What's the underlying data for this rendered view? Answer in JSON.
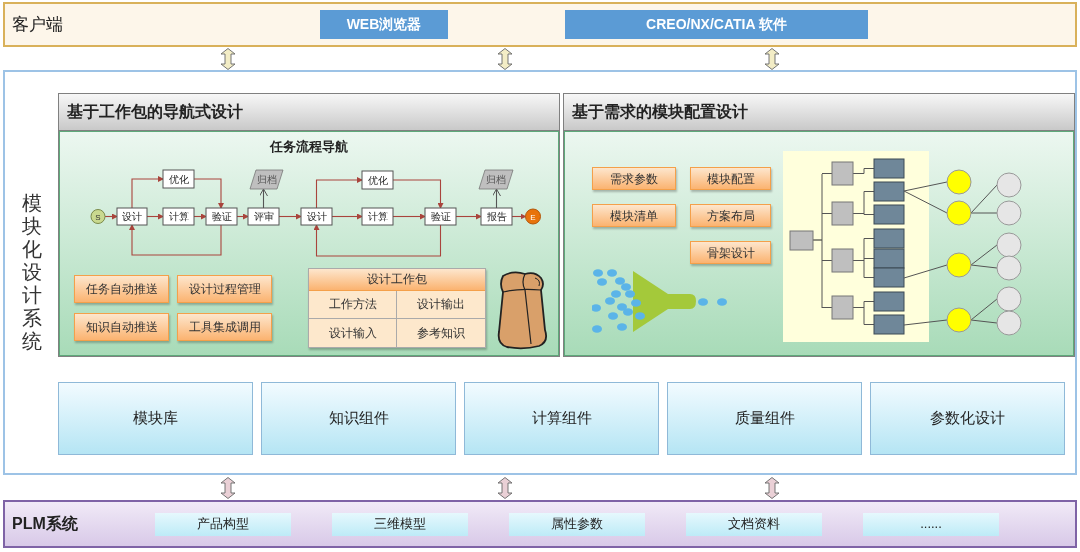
{
  "client": {
    "title": "客户端",
    "apps": [
      "WEB浏览器",
      "CREO/NX/CATIA 软件"
    ]
  },
  "system": {
    "title": "模块化设计系统",
    "left_panel": {
      "title": "基于工作包的导航式设计",
      "flow_title": "任务流程导航",
      "flow_nodes": [
        {
          "kind": "start",
          "label": "S"
        },
        {
          "kind": "step",
          "label": "设计"
        },
        {
          "kind": "step",
          "label": "优化"
        },
        {
          "kind": "step",
          "label": "计算"
        },
        {
          "kind": "step",
          "label": "验证"
        },
        {
          "kind": "archive",
          "label": "归档"
        },
        {
          "kind": "step",
          "label": "评审"
        },
        {
          "kind": "step",
          "label": "设计"
        },
        {
          "kind": "step",
          "label": "优化"
        },
        {
          "kind": "step",
          "label": "计算"
        },
        {
          "kind": "step",
          "label": "验证"
        },
        {
          "kind": "archive",
          "label": "归档"
        },
        {
          "kind": "step",
          "label": "报告"
        },
        {
          "kind": "end",
          "label": "E"
        }
      ],
      "features": [
        "任务自动推送",
        "设计过程管理",
        "知识自动推送",
        "工具集成调用"
      ],
      "work_package": {
        "title": "设计工作包",
        "cells": [
          "工作方法",
          "设计输出",
          "设计输入",
          "参考知识"
        ]
      }
    },
    "right_panel": {
      "title": "基于需求的模块配置设计",
      "features": [
        "需求参数",
        "模块配置",
        "模块清单",
        "方案布局",
        "骨架设计"
      ]
    },
    "components": [
      "模块库",
      "知识组件",
      "计算组件",
      "质量组件",
      "参数化设计"
    ]
  },
  "plm": {
    "title": "PLM系统",
    "items": [
      "产品构型",
      "三维模型",
      "属性参数",
      "文档资料",
      "......"
    ]
  }
}
